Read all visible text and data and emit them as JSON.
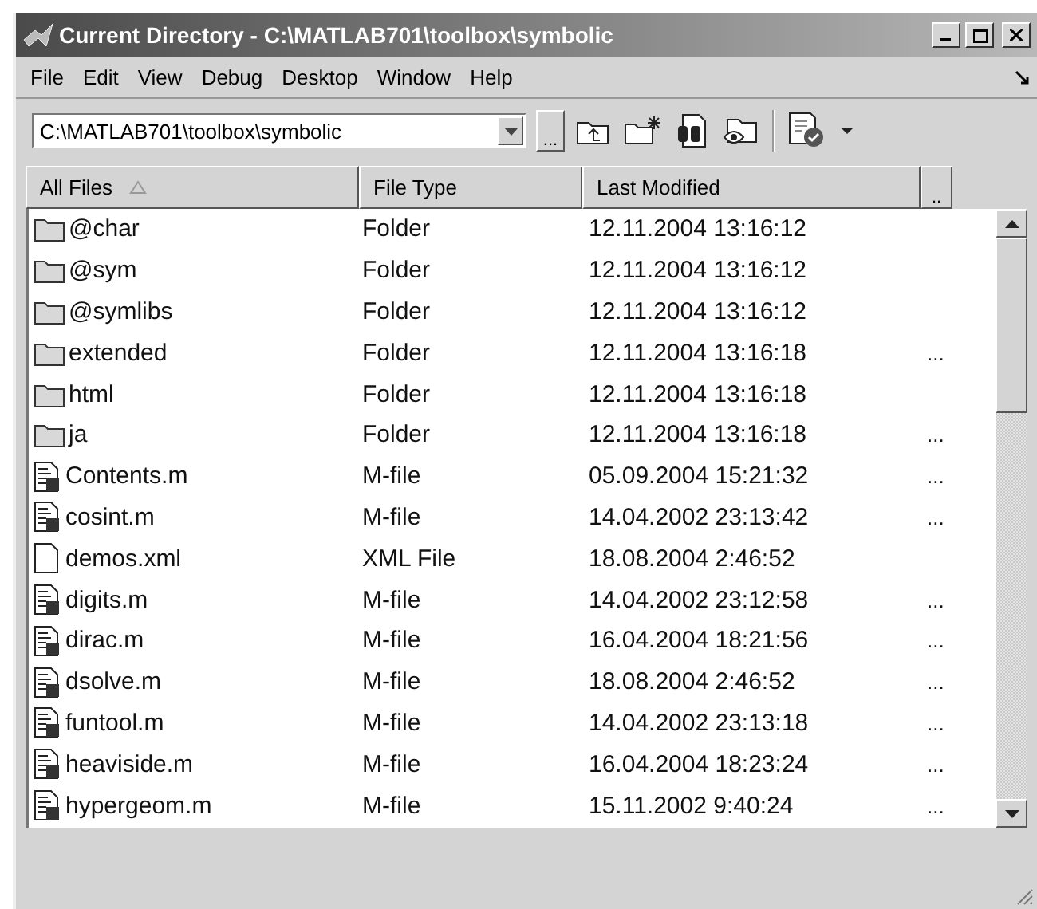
{
  "window": {
    "title": "Current Directory - C:\\MATLAB701\\toolbox\\symbolic"
  },
  "menu": [
    "File",
    "Edit",
    "View",
    "Debug",
    "Desktop",
    "Window",
    "Help"
  ],
  "toolbar": {
    "path": "C:\\MATLAB701\\toolbox\\symbolic",
    "browse_button": "..."
  },
  "table": {
    "columns": [
      "All Files",
      "File Type",
      "Last Modified"
    ],
    "column_4_button": "..",
    "rows": [
      {
        "kind": "folder",
        "name": "@char",
        "type": "Folder",
        "modified": "12.11.2004 13:16:12"
      },
      {
        "kind": "folder",
        "name": "@sym",
        "type": "Folder",
        "modified": "12.11.2004 13:16:12"
      },
      {
        "kind": "folder",
        "name": "@symlibs",
        "type": "Folder",
        "modified": "12.11.2004 13:16:12"
      },
      {
        "kind": "folder",
        "name": "extended",
        "type": "Folder",
        "modified": "12.11.2004 13:16:18",
        "column_4": "..."
      },
      {
        "kind": "folder",
        "name": "html",
        "type": "Folder",
        "modified": "12.11.2004 13:16:18"
      },
      {
        "kind": "folder",
        "name": "ja",
        "type": "Folder",
        "modified": "12.11.2004 13:16:18",
        "column_4": "..."
      },
      {
        "kind": "mfile",
        "name": "Contents.m",
        "type": "M-file",
        "modified": "05.09.2004 15:21:32",
        "column_4": "..."
      },
      {
        "kind": "mfile",
        "name": "cosint.m",
        "type": "M-file",
        "modified": "14.04.2002 23:13:42",
        "column_4": "..."
      },
      {
        "kind": "file",
        "name": "demos.xml",
        "type": "XML File",
        "modified": "18.08.2004 2:46:52"
      },
      {
        "kind": "mfile",
        "name": "digits.m",
        "type": "M-file",
        "modified": "14.04.2002 23:12:58",
        "column_4": "..."
      },
      {
        "kind": "mfile",
        "name": "dirac.m",
        "type": "M-file",
        "modified": "16.04.2004 18:21:56",
        "column_4": "..."
      },
      {
        "kind": "mfile",
        "name": "dsolve.m",
        "type": "M-file",
        "modified": "18.08.2004 2:46:52",
        "column_4": "..."
      },
      {
        "kind": "mfile",
        "name": "funtool.m",
        "type": "M-file",
        "modified": "14.04.2002 23:13:18",
        "column_4": "..."
      },
      {
        "kind": "mfile",
        "name": "heaviside.m",
        "type": "M-file",
        "modified": "16.04.2004 18:23:24",
        "column_4": "..."
      },
      {
        "kind": "mfile",
        "name": "hypergeom.m",
        "type": "M-file",
        "modified": "15.11.2002 9:40:24",
        "column_4": "..."
      }
    ]
  }
}
